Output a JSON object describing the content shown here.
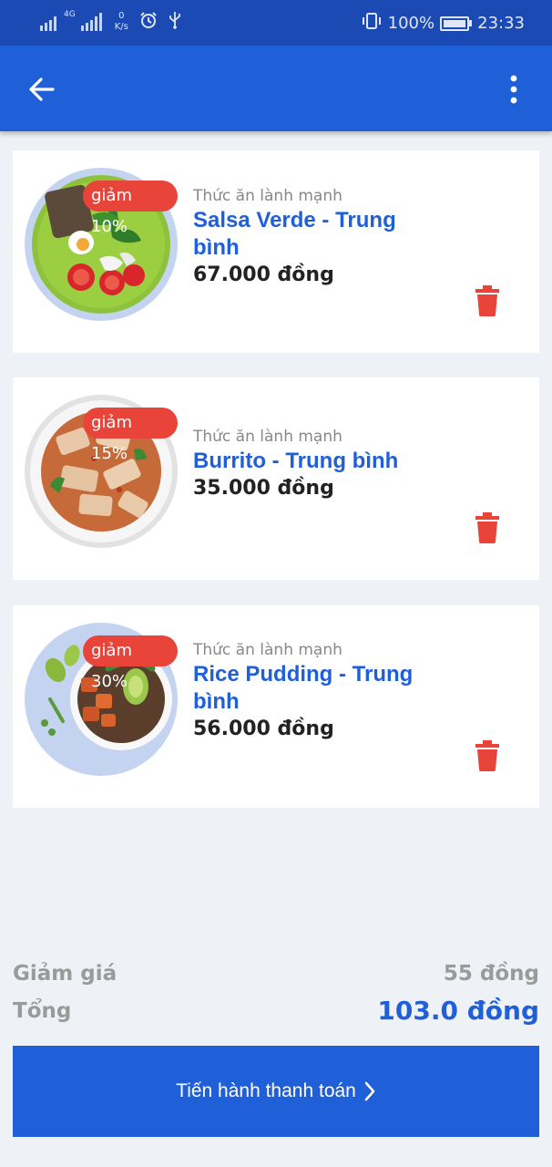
{
  "status_bar": {
    "network": "4G",
    "speed_value": "0",
    "speed_unit": "K/s",
    "alarm_icon": "alarm-icon",
    "usb_icon": "usb-icon",
    "vibrate_icon": "vibrate-icon",
    "battery_percent": "100%",
    "time": "23:33"
  },
  "app_bar": {
    "back_icon": "arrow-left-icon",
    "menu_icon": "more-vertical-icon",
    "color": "#1f5fd8"
  },
  "cart_items": [
    {
      "discount": "giảm 10%",
      "category": "Thức ăn lành mạnh",
      "title_line1": "Salsa Verde - Trung",
      "title_line2": "bình",
      "price": "67.000 đồng",
      "image": "salad-plate"
    },
    {
      "discount": "giảm 15%",
      "category": "Thức ăn lành mạnh",
      "title_line1": "Burrito - Trung bình",
      "title_line2": "",
      "price": "35.000 đồng",
      "image": "noodle-plate"
    },
    {
      "discount": "giảm 30%",
      "category": "Thức ăn lành mạnh",
      "title_line1": "Rice Pudding - Trung",
      "title_line2": "bình",
      "price": "56.000 đồng",
      "image": "bowl-plate"
    }
  ],
  "summary": {
    "discount_label": "Giảm giá",
    "discount_value": "55 đồng",
    "total_label": "Tổng",
    "total_value": "103.0 đồng"
  },
  "checkout": {
    "label": "Tiến hành thanh toán",
    "icon": "chevron-right-icon"
  },
  "colors": {
    "primary": "#1f5fd8",
    "status_bar": "#1b4ab5",
    "badge": "#e8443a",
    "trash": "#e8443a",
    "background": "#eef1f5"
  }
}
